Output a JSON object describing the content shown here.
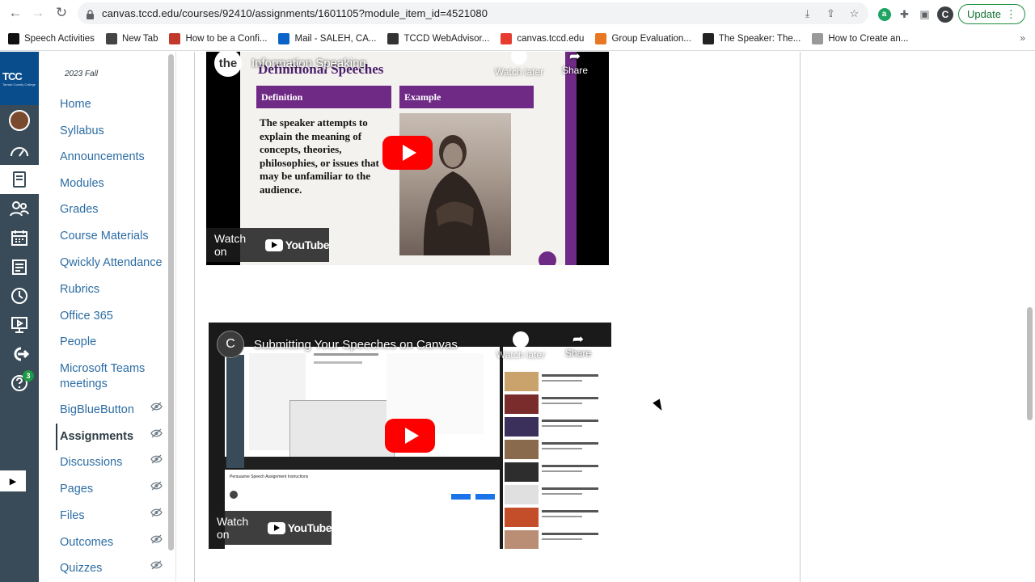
{
  "browser": {
    "url": "canvas.tccd.edu/courses/92410/assignments/1601105?module_item_id=4521080",
    "profile_initial": "C",
    "update_label": "Update"
  },
  "bookmarks": [
    {
      "label": "Speech Activities",
      "color": "#111111"
    },
    {
      "label": "New Tab",
      "color": "#444444"
    },
    {
      "label": "How to be a Confi...",
      "color": "#c0392b"
    },
    {
      "label": "Mail - SALEH, CA...",
      "color": "#0a64c8"
    },
    {
      "label": "TCCD WebAdvisor...",
      "color": "#333333"
    },
    {
      "label": "canvas.tccd.edu",
      "color": "#e63b2e"
    },
    {
      "label": "Group Evaluation...",
      "color": "#e87722"
    },
    {
      "label": "The Speaker: The...",
      "color": "#222222"
    },
    {
      "label": "How to Create an...",
      "color": "#999999"
    }
  ],
  "global_nav": {
    "logo_text": "TCC",
    "logo_sub": "Tarrant County College",
    "help_badge": "3"
  },
  "course_nav": {
    "term": "2023 Fall",
    "items": [
      {
        "label": "Home",
        "hidden": false
      },
      {
        "label": "Syllabus",
        "hidden": false
      },
      {
        "label": "Announcements",
        "hidden": false
      },
      {
        "label": "Modules",
        "hidden": false
      },
      {
        "label": "Grades",
        "hidden": false
      },
      {
        "label": "Course Materials",
        "hidden": false
      },
      {
        "label": "Qwickly Attendance",
        "hidden": false
      },
      {
        "label": "Rubrics",
        "hidden": false
      },
      {
        "label": "Office 365",
        "hidden": false
      },
      {
        "label": "People",
        "hidden": false
      },
      {
        "label": "Microsoft Teams meetings",
        "hidden": false
      },
      {
        "label": "BigBlueButton",
        "hidden": true
      },
      {
        "label": "Assignments",
        "hidden": true,
        "active": true
      },
      {
        "label": "Discussions",
        "hidden": true
      },
      {
        "label": "Pages",
        "hidden": true
      },
      {
        "label": "Files",
        "hidden": true
      },
      {
        "label": "Outcomes",
        "hidden": true
      },
      {
        "label": "Quizzes",
        "hidden": true
      }
    ]
  },
  "videos": [
    {
      "channel": "the",
      "title": "Information Speaking",
      "watch_later": "Watch later",
      "share": "Share",
      "watch_on": "Watch on",
      "youtube": "YouTube",
      "slide": {
        "title": "Definitional Speeches",
        "col1": "Definition",
        "col2": "Example",
        "body": "The speaker attempts to explain the meaning of concepts, theories, philosophies, or issues that may be unfamiliar to the audience."
      }
    },
    {
      "channel": "C",
      "title": "Submitting Your Speeches on Canvas",
      "watch_later": "Watch later",
      "share": "Share",
      "watch_on": "Watch on",
      "youtube": "YouTube",
      "screen_caption": "Persuasive Speech Assignment Instructions"
    }
  ]
}
